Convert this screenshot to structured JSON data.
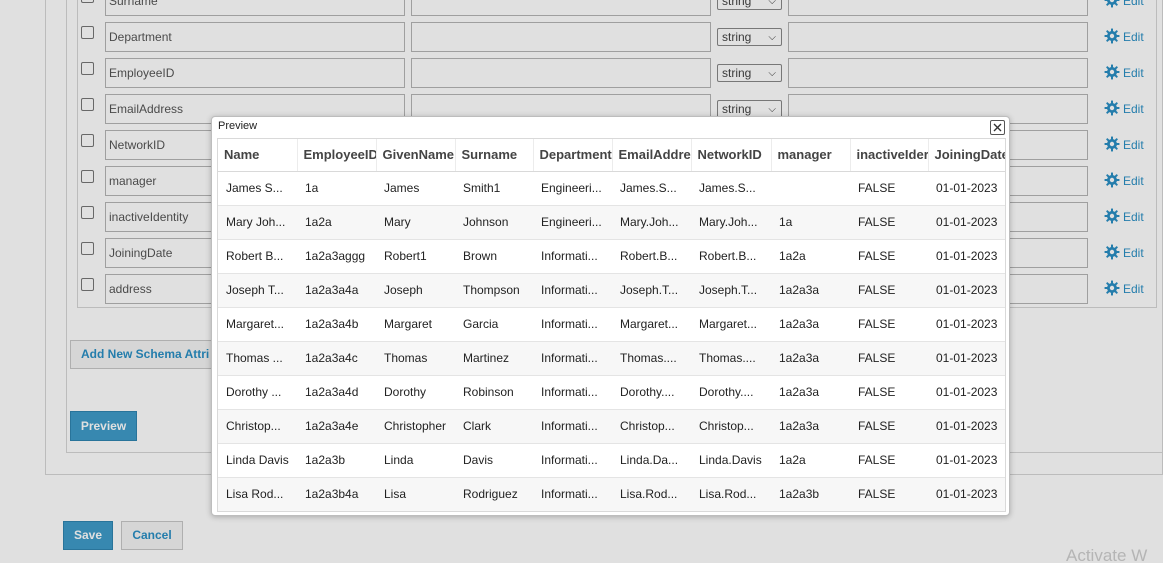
{
  "attributes": [
    {
      "name": "Surname",
      "type": "string",
      "edit": "Edit"
    },
    {
      "name": "Department",
      "type": "string",
      "edit": "Edit"
    },
    {
      "name": "EmployeeID",
      "type": "string",
      "edit": "Edit"
    },
    {
      "name": "EmailAddress",
      "type": "string",
      "edit": "Edit"
    },
    {
      "name": "NetworkID",
      "type": "",
      "edit": "Edit"
    },
    {
      "name": "manager",
      "type": "",
      "edit": "Edit"
    },
    {
      "name": "inactiveIdentity",
      "type": "",
      "edit": "Edit"
    },
    {
      "name": "JoiningDate",
      "type": "",
      "edit": "Edit"
    },
    {
      "name": "address",
      "type": "",
      "edit": "Edit"
    }
  ],
  "buttons": {
    "add_schema": "Add New Schema Attri",
    "preview": "Preview",
    "save": "Save",
    "cancel": "Cancel"
  },
  "watermark": "Activate W",
  "modal": {
    "title": "Preview",
    "columns": [
      "Name",
      "EmployeeID",
      "GivenName",
      "Surname",
      "Department",
      "EmailAddre",
      "NetworkID",
      "manager",
      "inactiveIder",
      "JoiningDate"
    ],
    "rows": [
      [
        "James S...",
        "1a",
        "James",
        "Smith1",
        "Engineeri...",
        "James.S...",
        "James.S...",
        "",
        "FALSE",
        "01-01-2023"
      ],
      [
        "Mary Joh...",
        "1a2a",
        "Mary",
        "Johnson",
        "Engineeri...",
        "Mary.Joh...",
        "Mary.Joh...",
        "1a",
        "FALSE",
        "01-01-2023"
      ],
      [
        "Robert B...",
        "1a2a3aggg",
        "Robert1",
        "Brown",
        "Informati...",
        "Robert.B...",
        "Robert.B...",
        "1a2a",
        "FALSE",
        "01-01-2023"
      ],
      [
        "Joseph T...",
        "1a2a3a4a",
        "Joseph",
        "Thompson",
        "Informati...",
        "Joseph.T...",
        "Joseph.T...",
        "1a2a3a",
        "FALSE",
        "01-01-2023"
      ],
      [
        "Margaret...",
        "1a2a3a4b",
        "Margaret",
        "Garcia",
        "Informati...",
        "Margaret...",
        "Margaret...",
        "1a2a3a",
        "FALSE",
        "01-01-2023"
      ],
      [
        "Thomas ...",
        "1a2a3a4c",
        "Thomas",
        "Martinez",
        "Informati...",
        "Thomas....",
        "Thomas....",
        "1a2a3a",
        "FALSE",
        "01-01-2023"
      ],
      [
        "Dorothy ...",
        "1a2a3a4d",
        "Dorothy",
        "Robinson",
        "Informati...",
        "Dorothy....",
        "Dorothy....",
        "1a2a3a",
        "FALSE",
        "01-01-2023"
      ],
      [
        "Christop...",
        "1a2a3a4e",
        "Christopher",
        "Clark",
        "Informati...",
        "Christop...",
        "Christop...",
        "1a2a3a",
        "FALSE",
        "01-01-2023"
      ],
      [
        "Linda Davis",
        "1a2a3b",
        "Linda",
        "Davis",
        "Informati...",
        "Linda.Da...",
        "Linda.Davis",
        "1a2a",
        "FALSE",
        "01-01-2023"
      ],
      [
        "Lisa Rod...",
        "1a2a3b4a",
        "Lisa",
        "Rodriguez",
        "Informati...",
        "Lisa.Rod...",
        "Lisa.Rod...",
        "1a2a3b",
        "FALSE",
        "01-01-2023"
      ]
    ]
  },
  "colors": {
    "accent": "#2a8fc4",
    "primary_button": "#3f9bc9"
  }
}
